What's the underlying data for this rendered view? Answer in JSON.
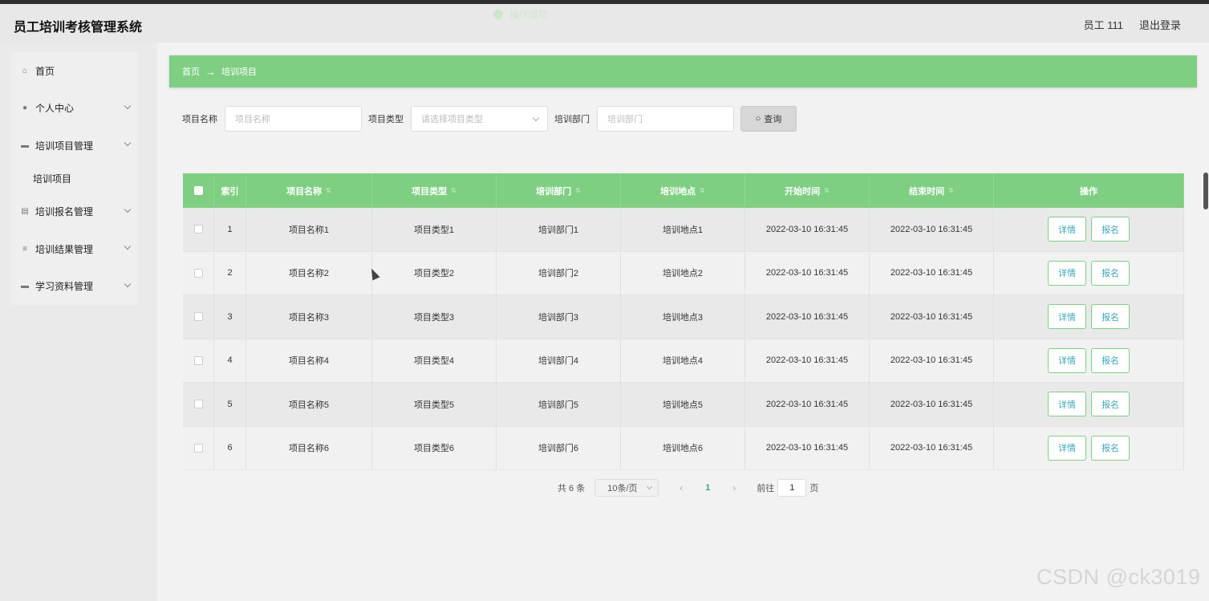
{
  "app": {
    "title": "员工培训考核管理系统"
  },
  "toast": {
    "text": "操作成功",
    "icon": "check-circle-icon"
  },
  "user": {
    "name": "员工 111",
    "logout": "退出登录"
  },
  "sidebar": {
    "items": [
      {
        "label": "首页",
        "icon": "home-icon"
      },
      {
        "label": "个人中心",
        "icon": "user-icon"
      },
      {
        "label": "培训项目管理",
        "icon": "briefcase-icon"
      },
      {
        "label": "培训报名管理",
        "icon": "clipboard-icon"
      },
      {
        "label": "培训结果管理",
        "icon": "list-icon"
      },
      {
        "label": "学习资料管理",
        "icon": "monitor-icon"
      }
    ],
    "subitem": "培训项目"
  },
  "breadcrumb": {
    "home": "首页",
    "arrow": "→",
    "current": "培训项目"
  },
  "filters": {
    "name_label": "项目名称",
    "name_placeholder": "项目名称",
    "type_label": "项目类型",
    "type_placeholder": "请选择项目类型",
    "dept_label": "培训部门",
    "dept_placeholder": "培训部门",
    "search_label": "查询"
  },
  "table": {
    "columns": [
      "索引",
      "项目名称",
      "项目类型",
      "培训部门",
      "培训地点",
      "开始时间",
      "结束时间",
      "操作"
    ],
    "rows": [
      {
        "index": "1",
        "name": "项目名称1",
        "type": "项目类型1",
        "dept": "培训部门1",
        "place": "培训地点1",
        "start": "2022-03-10 16:31:45",
        "end": "2022-03-10 16:31:45"
      },
      {
        "index": "2",
        "name": "项目名称2",
        "type": "项目类型2",
        "dept": "培训部门2",
        "place": "培训地点2",
        "start": "2022-03-10 16:31:45",
        "end": "2022-03-10 16:31:45"
      },
      {
        "index": "3",
        "name": "项目名称3",
        "type": "项目类型3",
        "dept": "培训部门3",
        "place": "培训地点3",
        "start": "2022-03-10 16:31:45",
        "end": "2022-03-10 16:31:45"
      },
      {
        "index": "4",
        "name": "项目名称4",
        "type": "项目类型4",
        "dept": "培训部门4",
        "place": "培训地点4",
        "start": "2022-03-10 16:31:45",
        "end": "2022-03-10 16:31:45"
      },
      {
        "index": "5",
        "name": "项目名称5",
        "type": "项目类型5",
        "dept": "培训部门5",
        "place": "培训地点5",
        "start": "2022-03-10 16:31:45",
        "end": "2022-03-10 16:31:45"
      },
      {
        "index": "6",
        "name": "项目名称6",
        "type": "项目类型6",
        "dept": "培训部门6",
        "place": "培训地点6",
        "start": "2022-03-10 16:31:45",
        "end": "2022-03-10 16:31:45"
      }
    ],
    "actions": {
      "detail": "详情",
      "enroll": "报名"
    }
  },
  "pagination": {
    "total": "共 6 条",
    "page_size": "10条/页",
    "current_page": "1",
    "goto_label": "前往",
    "goto_value": "1",
    "page_unit": "页"
  },
  "watermark": "CSDN @ck3019",
  "colors": {
    "accent": "#7fcf82",
    "link": "#3aa6b9"
  }
}
